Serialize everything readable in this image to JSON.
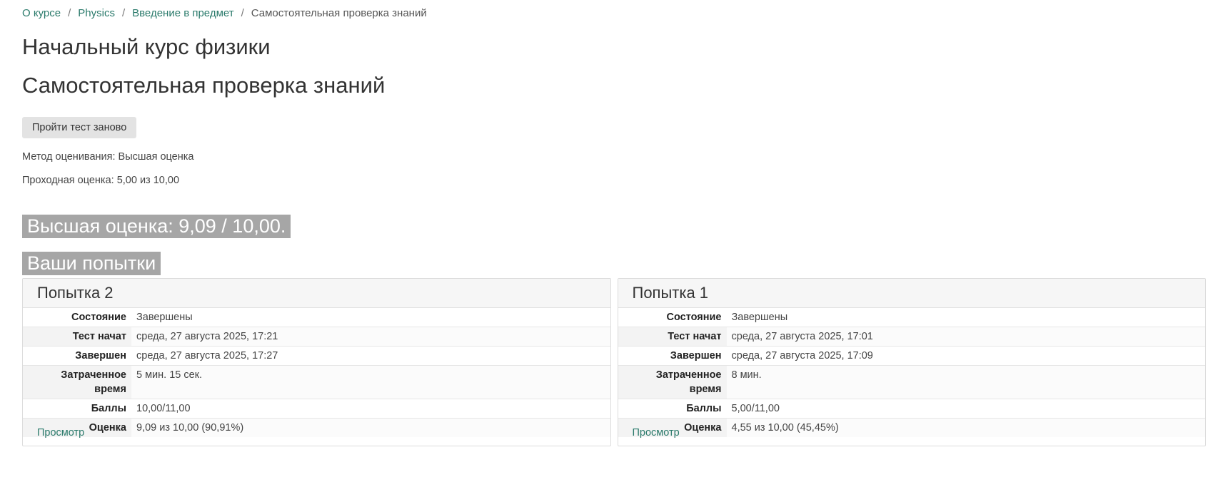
{
  "breadcrumb": {
    "items": [
      "О курсе",
      "Physics",
      "Введение в предмет"
    ],
    "current": "Самостоятельная проверка знаний",
    "separator": "/"
  },
  "course_title": "Начальный курс физики",
  "quiz_title": "Самостоятельная проверка знаний",
  "retake_button": "Пройти тест заново",
  "grading_method": "Метод оценивания: Высшая оценка",
  "passing_grade": "Проходная оценка: 5,00 из 10,00",
  "best_grade": "Высшая оценка: 9,09 / 10,00.",
  "attempts_heading": "Ваши попытки",
  "labels": {
    "state": "Состояние",
    "started": "Тест начат",
    "completed": "Завершен",
    "time_taken_1": "Затраченное",
    "time_taken_2": "время",
    "marks": "Баллы",
    "grade": "Оценка"
  },
  "attempts": [
    {
      "title": "Попытка 2",
      "state": "Завершены",
      "started": "среда, 27 августа 2025, 17:21",
      "completed": "среда, 27 августа 2025, 17:27",
      "time_taken": "5 мин. 15 сек.",
      "marks": "10,00/11,00",
      "grade": "9,09 из 10,00 (90,91%)",
      "review": "Просмотр"
    },
    {
      "title": "Попытка 1",
      "state": "Завершены",
      "started": "среда, 27 августа 2025, 17:01",
      "completed": "среда, 27 августа 2025, 17:09",
      "time_taken": "8 мин.",
      "marks": "5,00/11,00",
      "grade": "4,55 из 10,00 (45,45%)",
      "review": "Просмотр"
    }
  ],
  "colors": {
    "link": "#2a7a6b",
    "highlight_bg": "#a6a6a6",
    "button_bg": "#e3e3e3"
  }
}
